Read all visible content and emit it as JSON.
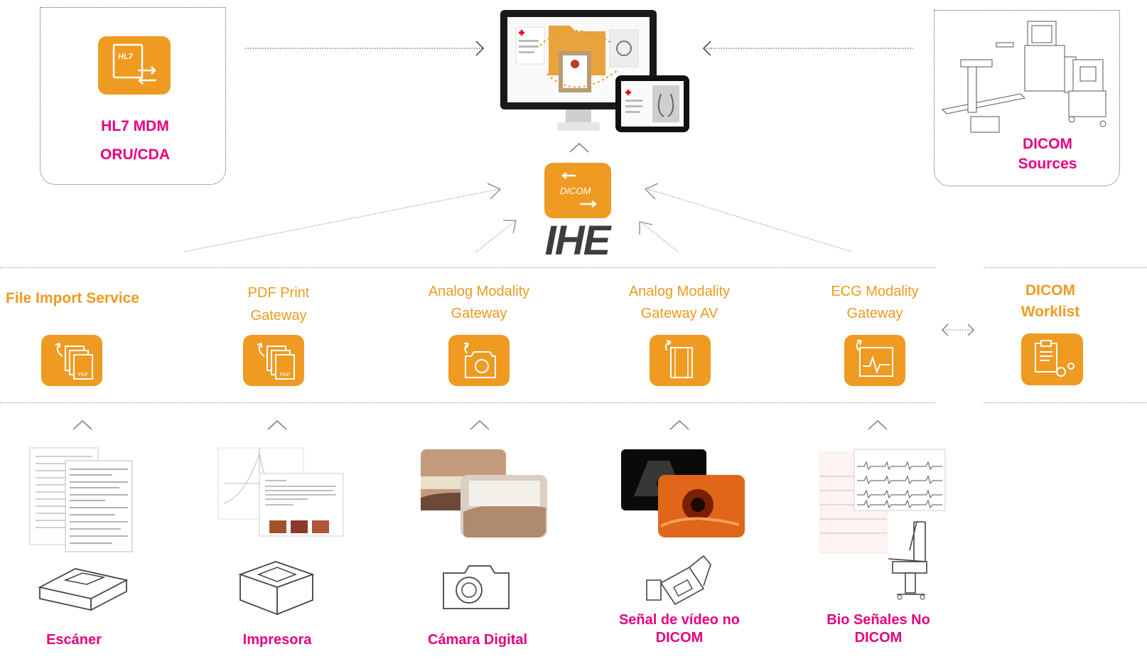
{
  "colors": {
    "accent": "#ef9a21",
    "brand_pink": "#e6007e",
    "line": "#999999"
  },
  "top": {
    "hl7": {
      "line1": "HL7 MDM",
      "line2": "ORU/CDA",
      "icon": "hl7-exchange-icon",
      "icon_text": "HL7"
    },
    "dicom_sources": {
      "line1": "DICOM",
      "line2": "Sources"
    },
    "center": {
      "dicom_icon_text": "DICOM",
      "ihe_logo_text": "IHE"
    }
  },
  "gateways": [
    {
      "line1": "File Import Service",
      "line2": "",
      "icon": "pdf-documents-icon",
      "icon_text": "PDF"
    },
    {
      "line1": "PDF Print",
      "line2": "Gateway",
      "icon": "pdf-documents-icon",
      "icon_text": "PDF"
    },
    {
      "line1": "Analog Modality",
      "line2": "Gateway",
      "icon": "camera-capture-icon"
    },
    {
      "line1": "Analog Modality",
      "line2": "Gateway AV",
      "icon": "film-capture-icon"
    },
    {
      "line1": "ECG Modality",
      "line2": "Gateway",
      "icon": "ecg-capture-icon"
    }
  ],
  "worklist": {
    "line1": "DICOM",
    "line2": "Worklist",
    "icon": "clipboard-gears-icon"
  },
  "sources": [
    {
      "line1": "Escáner",
      "line2": "",
      "device": "scanner-icon"
    },
    {
      "line1": "Impresora",
      "line2": "",
      "device": "printer-icon"
    },
    {
      "line1": "Cámara Digital",
      "line2": "",
      "device": "camera-icon"
    },
    {
      "line1": "Señal de vídeo no",
      "line2": "DICOM",
      "device": "video-camera-icon"
    },
    {
      "line1": "Bio Señales No",
      "line2": "DICOM",
      "device": "ecg-cart-icon"
    }
  ]
}
